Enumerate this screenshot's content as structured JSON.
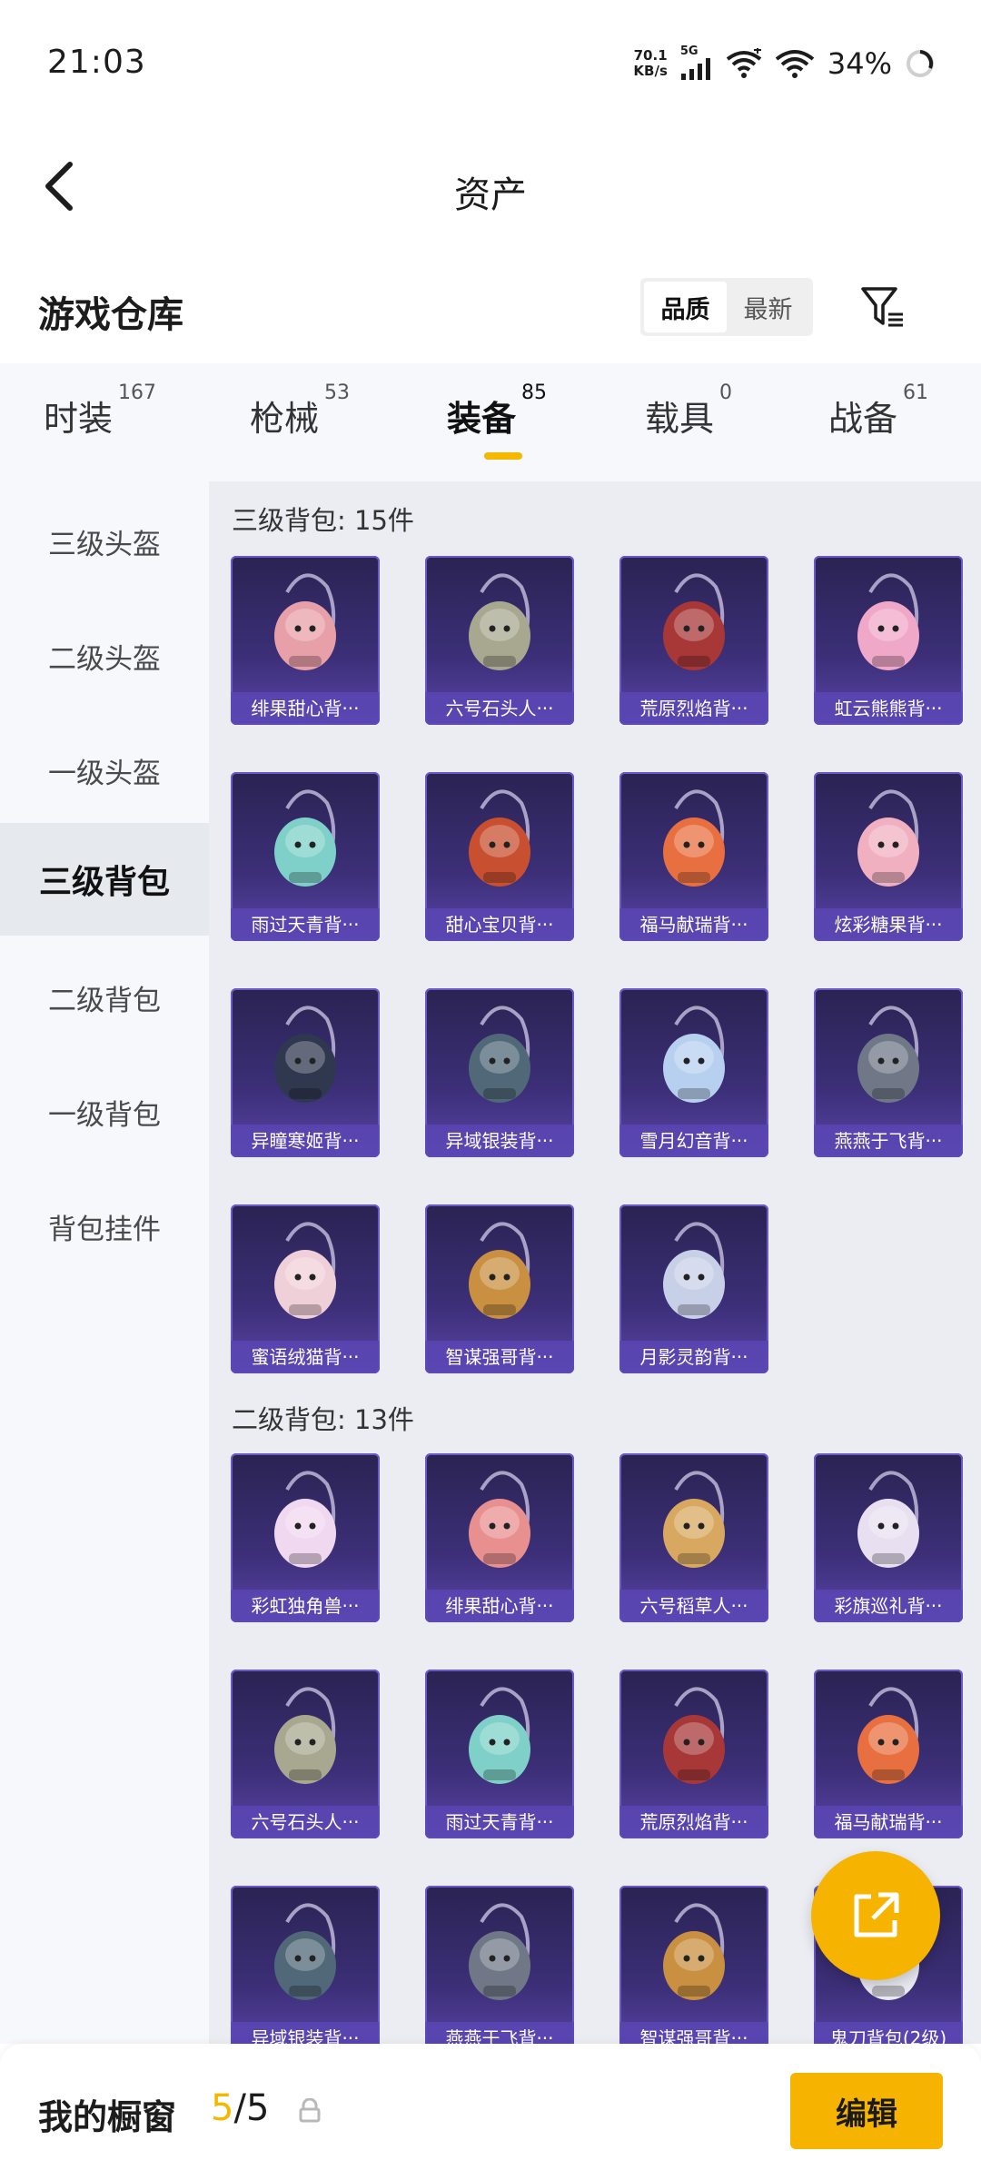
{
  "status_bar": {
    "time": "21:03",
    "net_speed_value": "70.1",
    "net_speed_unit": "KB/s",
    "network_type": "5G",
    "battery": "34%"
  },
  "header": {
    "title": "资产"
  },
  "warehouse": {
    "title": "游戏仓库",
    "sort_options": [
      "品质",
      "最新"
    ],
    "active_sort": "品质"
  },
  "tabs": [
    {
      "label": "时装",
      "count": "167"
    },
    {
      "label": "枪械",
      "count": "53"
    },
    {
      "label": "装备",
      "count": "85",
      "active": true
    },
    {
      "label": "载具",
      "count": "0"
    },
    {
      "label": "战备",
      "count": "61"
    }
  ],
  "sidebar": {
    "items": [
      {
        "label": "三级头盔"
      },
      {
        "label": "二级头盔"
      },
      {
        "label": "一级头盔"
      },
      {
        "label": "三级背包",
        "active": true
      },
      {
        "label": "二级背包"
      },
      {
        "label": "一级背包"
      },
      {
        "label": "背包挂件"
      }
    ]
  },
  "sections": [
    {
      "title": "三级背包: 15件",
      "items": [
        {
          "label": "绯果甜心背···",
          "color": "#e8a0a8"
        },
        {
          "label": "六号石头人···",
          "color": "#a8a890"
        },
        {
          "label": "荒原烈焰背···",
          "color": "#a83838"
        },
        {
          "label": "虹云熊熊背···",
          "color": "#f0a8c8"
        },
        {
          "label": "雨过天青背···",
          "color": "#7ed0c8"
        },
        {
          "label": "甜心宝贝背···",
          "color": "#c85030"
        },
        {
          "label": "福马献瑞背···",
          "color": "#e87040"
        },
        {
          "label": "炫彩糖果背···",
          "color": "#f0b0c0"
        },
        {
          "label": "异瞳寒姬背···",
          "color": "#303850"
        },
        {
          "label": "异域银装背···",
          "color": "#506878"
        },
        {
          "label": "雪月幻音背···",
          "color": "#b8d0f0"
        },
        {
          "label": "燕燕于飞背···",
          "color": "#707888"
        },
        {
          "label": "蜜语绒猫背···",
          "color": "#f0d0d8"
        },
        {
          "label": "智谋强哥背···",
          "color": "#c89040"
        },
        {
          "label": "月影灵韵背···",
          "color": "#c8d0e8"
        }
      ]
    },
    {
      "title": "二级背包: 13件",
      "items": [
        {
          "label": "彩虹独角兽···",
          "color": "#f0d8f0"
        },
        {
          "label": "绯果甜心背···",
          "color": "#e89090"
        },
        {
          "label": "六号稻草人···",
          "color": "#d8a860"
        },
        {
          "label": "彩旗巡礼背···",
          "color": "#e8e0f0"
        },
        {
          "label": "六号石头人···",
          "color": "#a8a890"
        },
        {
          "label": "雨过天青背···",
          "color": "#7ed0c8"
        },
        {
          "label": "荒原烈焰背···",
          "color": "#a83838"
        },
        {
          "label": "福马献瑞背···",
          "color": "#e87040"
        },
        {
          "label": "异域银装背···",
          "color": "#506878"
        },
        {
          "label": "燕燕于飞背···",
          "color": "#707888"
        },
        {
          "label": "智谋强哥背···",
          "color": "#c89040"
        },
        {
          "label": "鬼刀背包(2级)",
          "color": "#e8e8f0"
        }
      ]
    }
  ],
  "bottom_bar": {
    "label": "我的橱窗",
    "count_current": "5",
    "count_sep": "/",
    "count_total": "5",
    "edit_label": "编辑"
  },
  "colors": {
    "accent": "#f5b800",
    "item_bg_top": "#2a2352",
    "item_bg_bottom": "#5a45a8",
    "item_label_bg": "#5a46b4"
  }
}
